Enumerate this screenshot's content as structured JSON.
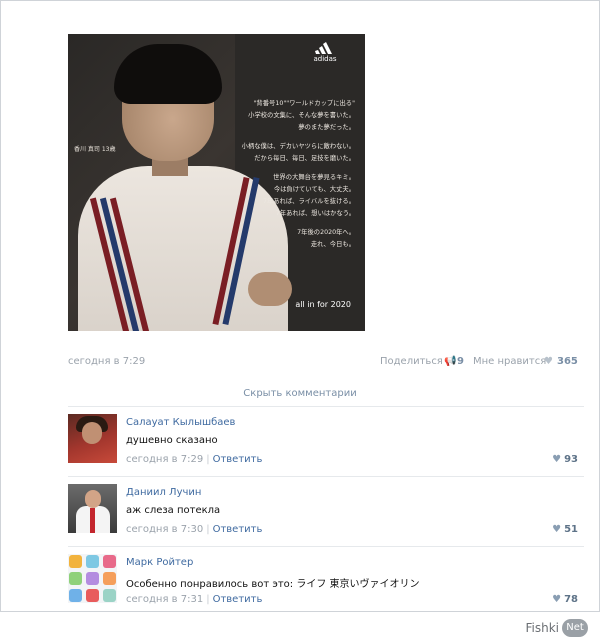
{
  "post": {
    "image": {
      "brand": "adidas",
      "caption_name": "香川 真司 13歳",
      "lines": [
        "\"背番号10\"\"ワールドカップに出る\"",
        "小学校の文集に、そんな夢を書いた。",
        "夢のまた夢だった。",
        "",
        "小柄な僕は、デカいヤツらに敵わない。",
        "だから毎日、毎日、足技を磨いた。",
        "",
        "世界の大舞台を夢見るキミ。",
        "今は負けていても、大丈夫。",
        "7年あれば、ライバルを抜ける。",
        "7年あれば、想いはかなう。",
        "",
        "7年後の2020年へ。",
        "走れ、今日も。"
      ],
      "slogan": "all in for 2020"
    },
    "date": "сегодня в 7:29",
    "share_label": "Поделиться",
    "share_count": "9",
    "like_label": "Мне нравится",
    "like_count": "365",
    "hide_comments": "Скрыть комментарии"
  },
  "comments": [
    {
      "author": "Салауат Кылышбаев",
      "text": "душевно сказано",
      "date": "сегодня в 7:29",
      "reply": "Ответить",
      "likes": "93"
    },
    {
      "author": "Даниил Лучин",
      "text": "аж слеза потекла",
      "date": "сегодня в 7:30",
      "reply": "Ответить",
      "likes": "51"
    },
    {
      "author": "Марк Ройтер",
      "text": "Особенно понравилось вот это: ライフ 東京いヴァイオリン",
      "date": "сегодня в 7:31",
      "reply": "Ответить",
      "likes": "78"
    }
  ],
  "watermark": {
    "brand": "Fishki",
    "suffix": "Net"
  },
  "colors": {
    "link": "#3f6aa0",
    "muted": "#9aa2ab",
    "border": "#cfd3d8"
  }
}
